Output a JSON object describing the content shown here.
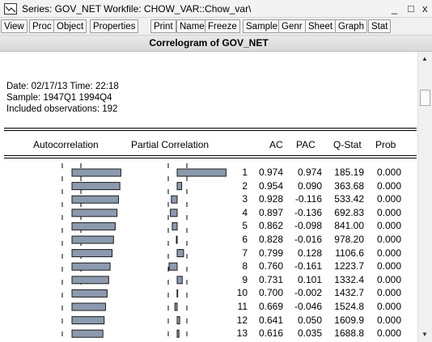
{
  "window": {
    "title": "Series: GOV_NET   Workfile: CHOW_VAR::Chow_var\\",
    "minimize_glyph": "_",
    "maximize_glyph": "□",
    "close_glyph": "x",
    "icon": "series-icon"
  },
  "toolbar": {
    "buttons": [
      "View",
      "Proc",
      "Object",
      "Properties",
      "Print",
      "Name",
      "Freeze",
      "Sample",
      "Genr",
      "Sheet",
      "Graph",
      "Stat"
    ]
  },
  "view_title": "Correlogram of GOV_NET",
  "info": {
    "date_line": "Date: 02/17/13   Time: 22:18",
    "sample_line": "Sample: 1947Q1 1994Q4",
    "obs_line": "Included observations: 192"
  },
  "columns": {
    "autocorrelation": "Autocorrelation",
    "partial_correlation": "Partial Correlation",
    "ac": "AC",
    "pac": "PAC",
    "qstat": "Q-Stat",
    "prob": "Prob"
  },
  "colors": {
    "bar_fill": "#8c9aae",
    "bar_edge": "#1a1a1a"
  },
  "chart_data": {
    "type": "table",
    "rows": [
      {
        "lag": 1,
        "ac": 0.974,
        "pac": 0.974,
        "q": 185.19,
        "prob": 0.0
      },
      {
        "lag": 2,
        "ac": 0.954,
        "pac": 0.09,
        "q": 363.68,
        "prob": 0.0
      },
      {
        "lag": 3,
        "ac": 0.928,
        "pac": -0.116,
        "q": 533.42,
        "prob": 0.0
      },
      {
        "lag": 4,
        "ac": 0.897,
        "pac": -0.136,
        "q": 692.83,
        "prob": 0.0
      },
      {
        "lag": 5,
        "ac": 0.862,
        "pac": -0.098,
        "q": 841.0,
        "prob": 0.0
      },
      {
        "lag": 6,
        "ac": 0.828,
        "pac": -0.016,
        "q": 978.2,
        "prob": 0.0
      },
      {
        "lag": 7,
        "ac": 0.799,
        "pac": 0.128,
        "q": 1106.6,
        "prob": 0.0
      },
      {
        "lag": 8,
        "ac": 0.76,
        "pac": -0.161,
        "q": 1223.7,
        "prob": 0.0
      },
      {
        "lag": 9,
        "ac": 0.731,
        "pac": 0.101,
        "q": 1332.4,
        "prob": 0.0
      },
      {
        "lag": 10,
        "ac": 0.7,
        "pac": -0.002,
        "q": 1432.7,
        "prob": 0.0
      },
      {
        "lag": 11,
        "ac": 0.669,
        "pac": -0.046,
        "q": 1524.8,
        "prob": 0.0
      },
      {
        "lag": 12,
        "ac": 0.641,
        "pac": 0.05,
        "q": 1609.9,
        "prob": 0.0
      },
      {
        "lag": 13,
        "ac": 0.616,
        "pac": 0.035,
        "q": 1688.8,
        "prob": 0.0
      }
    ],
    "ac_display": [
      "0.974",
      "0.954",
      "0.928",
      "0.897",
      "0.862",
      "0.828",
      "0.799",
      "0.760",
      "0.731",
      "0.700",
      "0.669",
      "0.641",
      "0.616"
    ],
    "pac_display": [
      "0.974",
      "0.090",
      "-0.116",
      "-0.136",
      "-0.098",
      "-0.016",
      "0.128",
      "-0.161",
      "0.101",
      "-0.002",
      "-0.046",
      "0.050",
      "0.035"
    ],
    "q_display": [
      "185.19",
      "363.68",
      "533.42",
      "692.83",
      "841.00",
      "978.20",
      "1106.6",
      "1223.7",
      "1332.4",
      "1432.7",
      "1524.8",
      "1609.9",
      "1688.8"
    ],
    "prob_display": [
      "0.000",
      "0.000",
      "0.000",
      "0.000",
      "0.000",
      "0.000",
      "0.000",
      "0.000",
      "0.000",
      "0.000",
      "0.000",
      "0.000",
      "0.000"
    ]
  }
}
